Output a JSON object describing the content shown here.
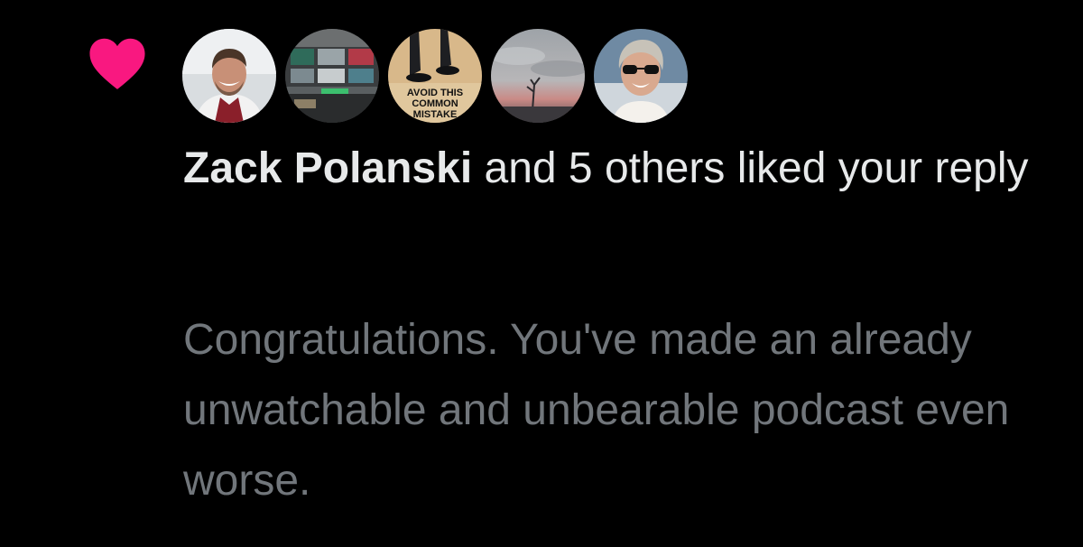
{
  "notification": {
    "type_icon": "heart-icon",
    "icon_color": "#f91880",
    "avatars": [
      {
        "icon": "avatar-photo-man-smiling"
      },
      {
        "icon": "avatar-photo-trading-desk"
      },
      {
        "icon": "avatar-photo-avoid-this-common-mistake",
        "caption": "AVOID THIS COMMON MISTAKE"
      },
      {
        "icon": "avatar-photo-sunset-sky"
      },
      {
        "icon": "avatar-photo-woman-sunglasses"
      }
    ],
    "actor_name": "Zack Polanski",
    "action_text": " and 5 others liked your reply",
    "reply_excerpt": "Congratulations. You've made an already unwatchable and unbearable podcast even worse."
  },
  "colors": {
    "background": "#000000",
    "primary_text": "#e7e9ea",
    "secondary_text": "#71767b",
    "like_pink": "#f91880"
  }
}
